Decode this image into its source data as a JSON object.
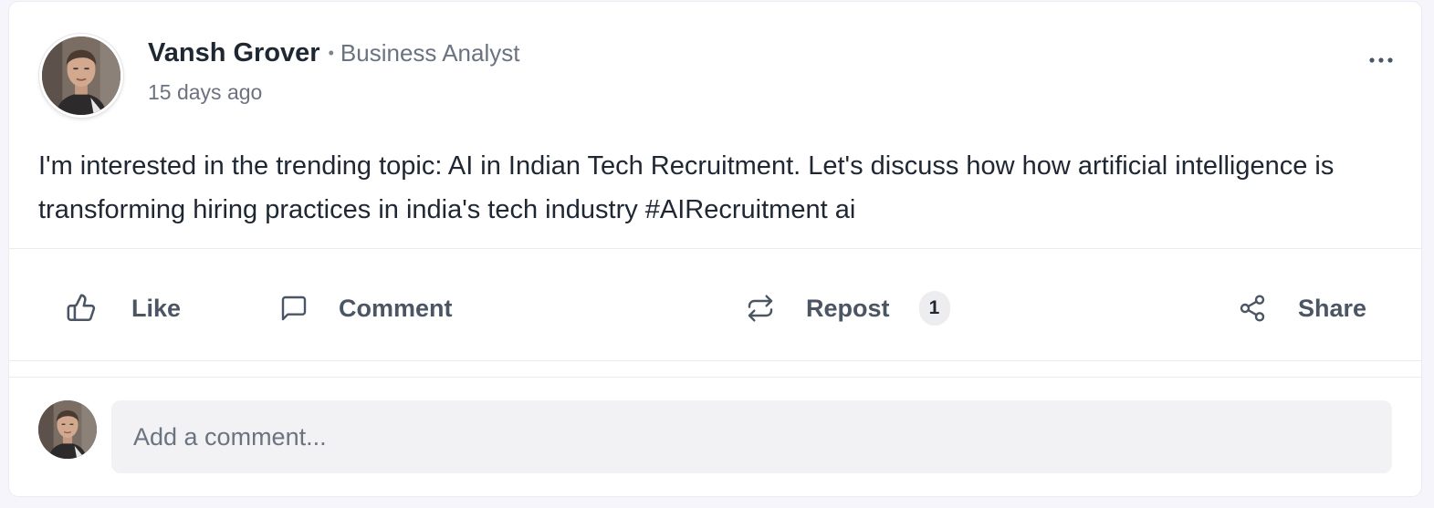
{
  "post": {
    "author": {
      "name": "Vansh Grover",
      "separator": "•",
      "title": "Business Analyst",
      "avatar_icon": "user-avatar-photo"
    },
    "timestamp": "15 days ago",
    "body": "I'm interested in the trending topic: AI in Indian Tech Recruitment. Let's discuss how how artificial intelligence is transforming hiring practices in india's tech industry #AIRecruitment ai",
    "more_icon": "more-horizontal-icon"
  },
  "actions": {
    "like": {
      "label": "Like",
      "icon": "thumbs-up-icon"
    },
    "comment": {
      "label": "Comment",
      "icon": "message-square-icon"
    },
    "repost": {
      "label": "Repost",
      "icon": "repeat-icon",
      "count": "1"
    },
    "share": {
      "label": "Share",
      "icon": "share-icon"
    }
  },
  "comment_box": {
    "placeholder": "Add a comment...",
    "value": ""
  },
  "colors": {
    "text_primary": "#1f2733",
    "text_secondary": "#6b7280",
    "action_text": "#4b5563",
    "input_background": "#f2f2f5",
    "page_background": "#f6f5fc"
  }
}
